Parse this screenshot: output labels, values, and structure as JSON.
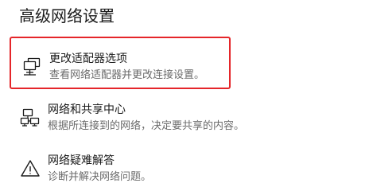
{
  "section": {
    "title": "高级网络设置"
  },
  "options": [
    {
      "id": "adapter",
      "label": "更改适配器选项",
      "description": "查看网络适配器并更改连接设置。",
      "icon": "network-adapter-icon",
      "highlighted": true
    },
    {
      "id": "sharing",
      "label": "网络和共享中心",
      "description": "根据所连接到的网络，决定要共享的内容。",
      "icon": "sharing-center-icon",
      "highlighted": false
    },
    {
      "id": "troubleshoot",
      "label": "网络疑难解答",
      "description": "诊断并解决网络问题。",
      "icon": "warning-icon",
      "highlighted": false
    }
  ],
  "colors": {
    "highlight_border": "#e5262a",
    "description_text": "#6b6b6b",
    "label_text": "#1a1a1a"
  }
}
